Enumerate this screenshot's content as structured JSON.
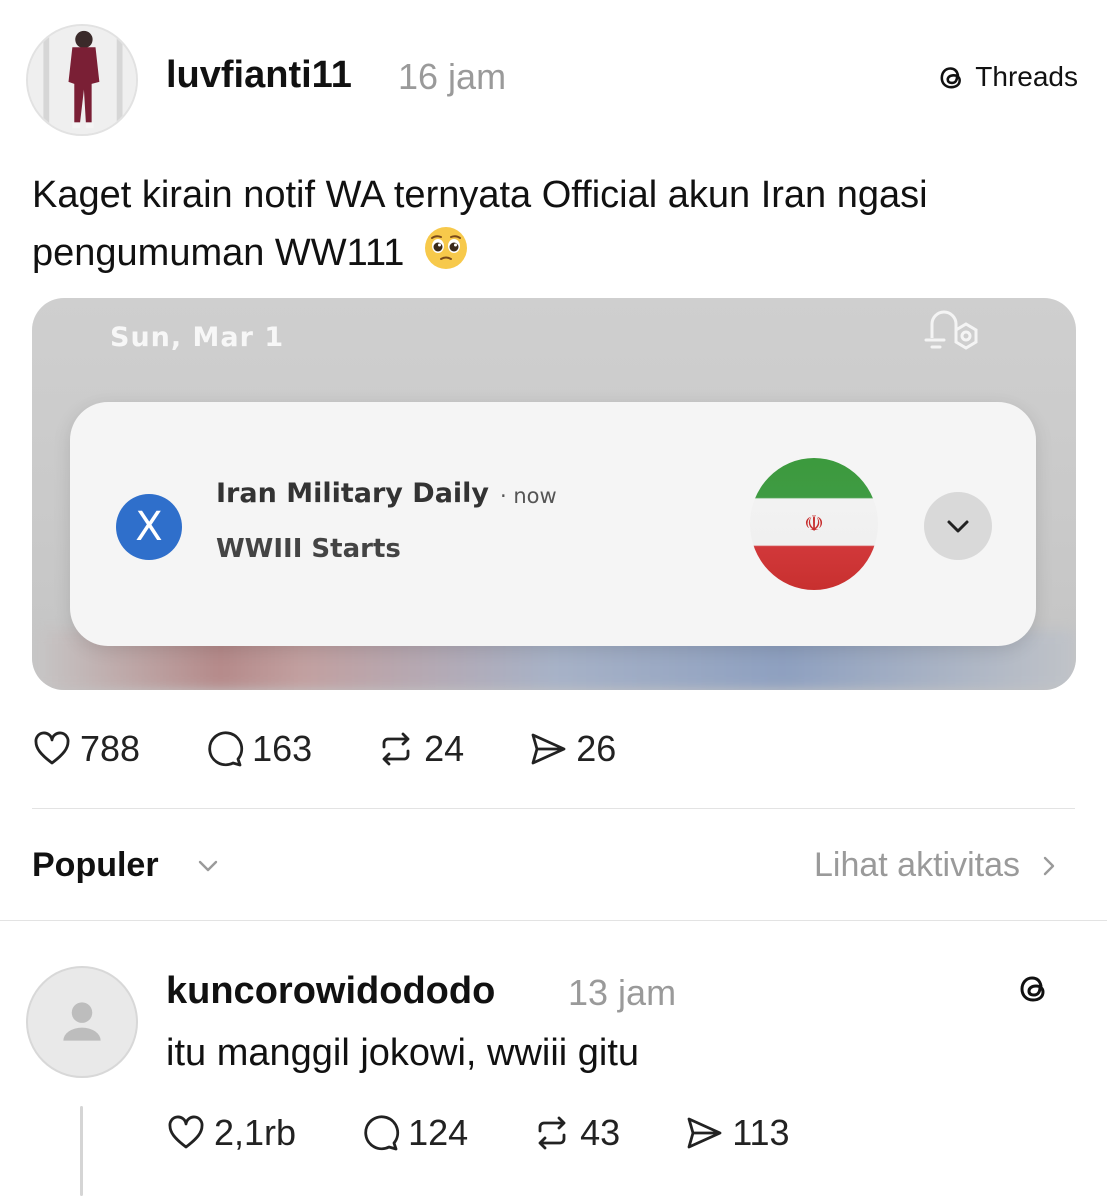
{
  "post": {
    "username": "luvfianti11",
    "time": "16 jam",
    "platform_label": "Threads",
    "text": "Kaget kirain notif WA ternyata Official akun Iran ngasi pengumuman WW111",
    "emoji_icon": "pleading-face-icon",
    "screenshot": {
      "date": "Sun, Mar 1",
      "notification": {
        "app_icon": "x-logo-icon",
        "app_glyph": "X",
        "title": "Iran Military Daily",
        "separator": "·",
        "time": "now",
        "body": "WWIII Starts",
        "image_icon": "iran-flag-icon",
        "emblem_glyph": "☫"
      }
    },
    "stats": {
      "likes": "788",
      "comments": "163",
      "reposts": "24",
      "shares": "26"
    }
  },
  "sort": {
    "label": "Populer",
    "activity_label": "Lihat aktivitas"
  },
  "reply": {
    "username": "kuncorowidododo",
    "time": "13 jam",
    "text": "itu manggil jokowi, wwiii gitu",
    "stats": {
      "likes": "2,1rb",
      "comments": "124",
      "reposts": "43",
      "shares": "113"
    }
  },
  "colors": {
    "muted_text": "#9a9a9a",
    "x_badge_blue": "#2f6fcb",
    "divider": "#e3e3e3"
  }
}
